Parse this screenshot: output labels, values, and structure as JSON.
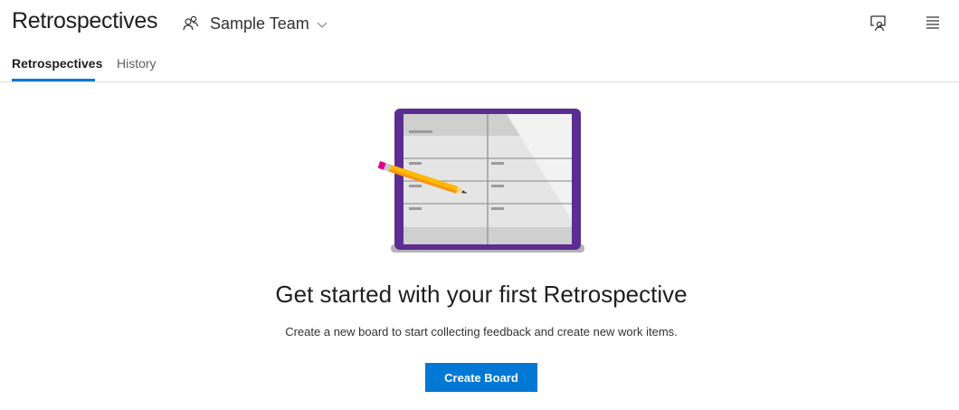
{
  "header": {
    "title": "Retrospectives",
    "team": {
      "name": "Sample Team",
      "icon": "people-icon",
      "dropdown_icon": "chevron-down-icon"
    },
    "actions": [
      {
        "name": "feedback",
        "icon": "person-chat-icon"
      },
      {
        "name": "menu",
        "icon": "hamburger-menu-icon"
      }
    ]
  },
  "tabs": [
    {
      "label": "Retrospectives",
      "active": true
    },
    {
      "label": "History",
      "active": false
    }
  ],
  "empty_state": {
    "illustration": "board-with-pencil-illustration",
    "headline": "Get started with your first Retrospective",
    "subtext": "Create a new board to start collecting feedback and create new work items.",
    "button_label": "Create Board"
  },
  "colors": {
    "accent": "#0078d4",
    "board_frame": "#5c2d91",
    "pencil": "#ffb900"
  }
}
